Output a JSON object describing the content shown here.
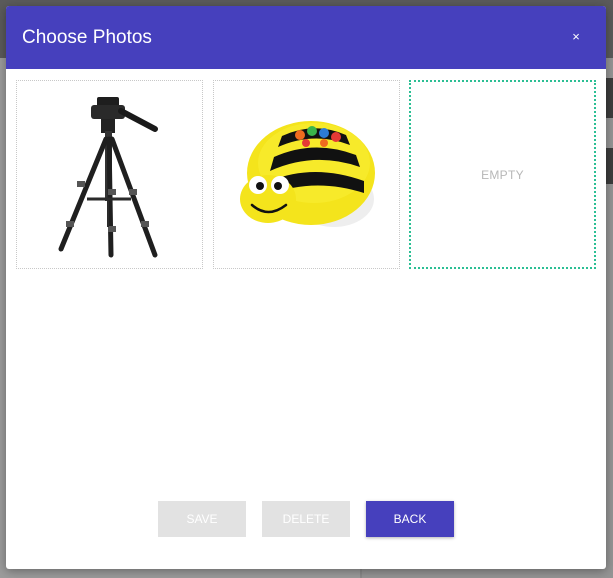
{
  "modal": {
    "title": "Choose Photos",
    "close_label": "×",
    "header_color": "#4640bd"
  },
  "photos": [
    {
      "kind": "image",
      "icon": "tripod-photo"
    },
    {
      "kind": "image",
      "icon": "bee-robot-photo"
    },
    {
      "kind": "empty",
      "label": "EMPTY",
      "selected": true,
      "border_color": "#2bbf94"
    }
  ],
  "buttons": {
    "save_label": "SAVE",
    "delete_label": "DELETE",
    "back_label": "BACK",
    "save_enabled": false,
    "delete_enabled": false
  }
}
